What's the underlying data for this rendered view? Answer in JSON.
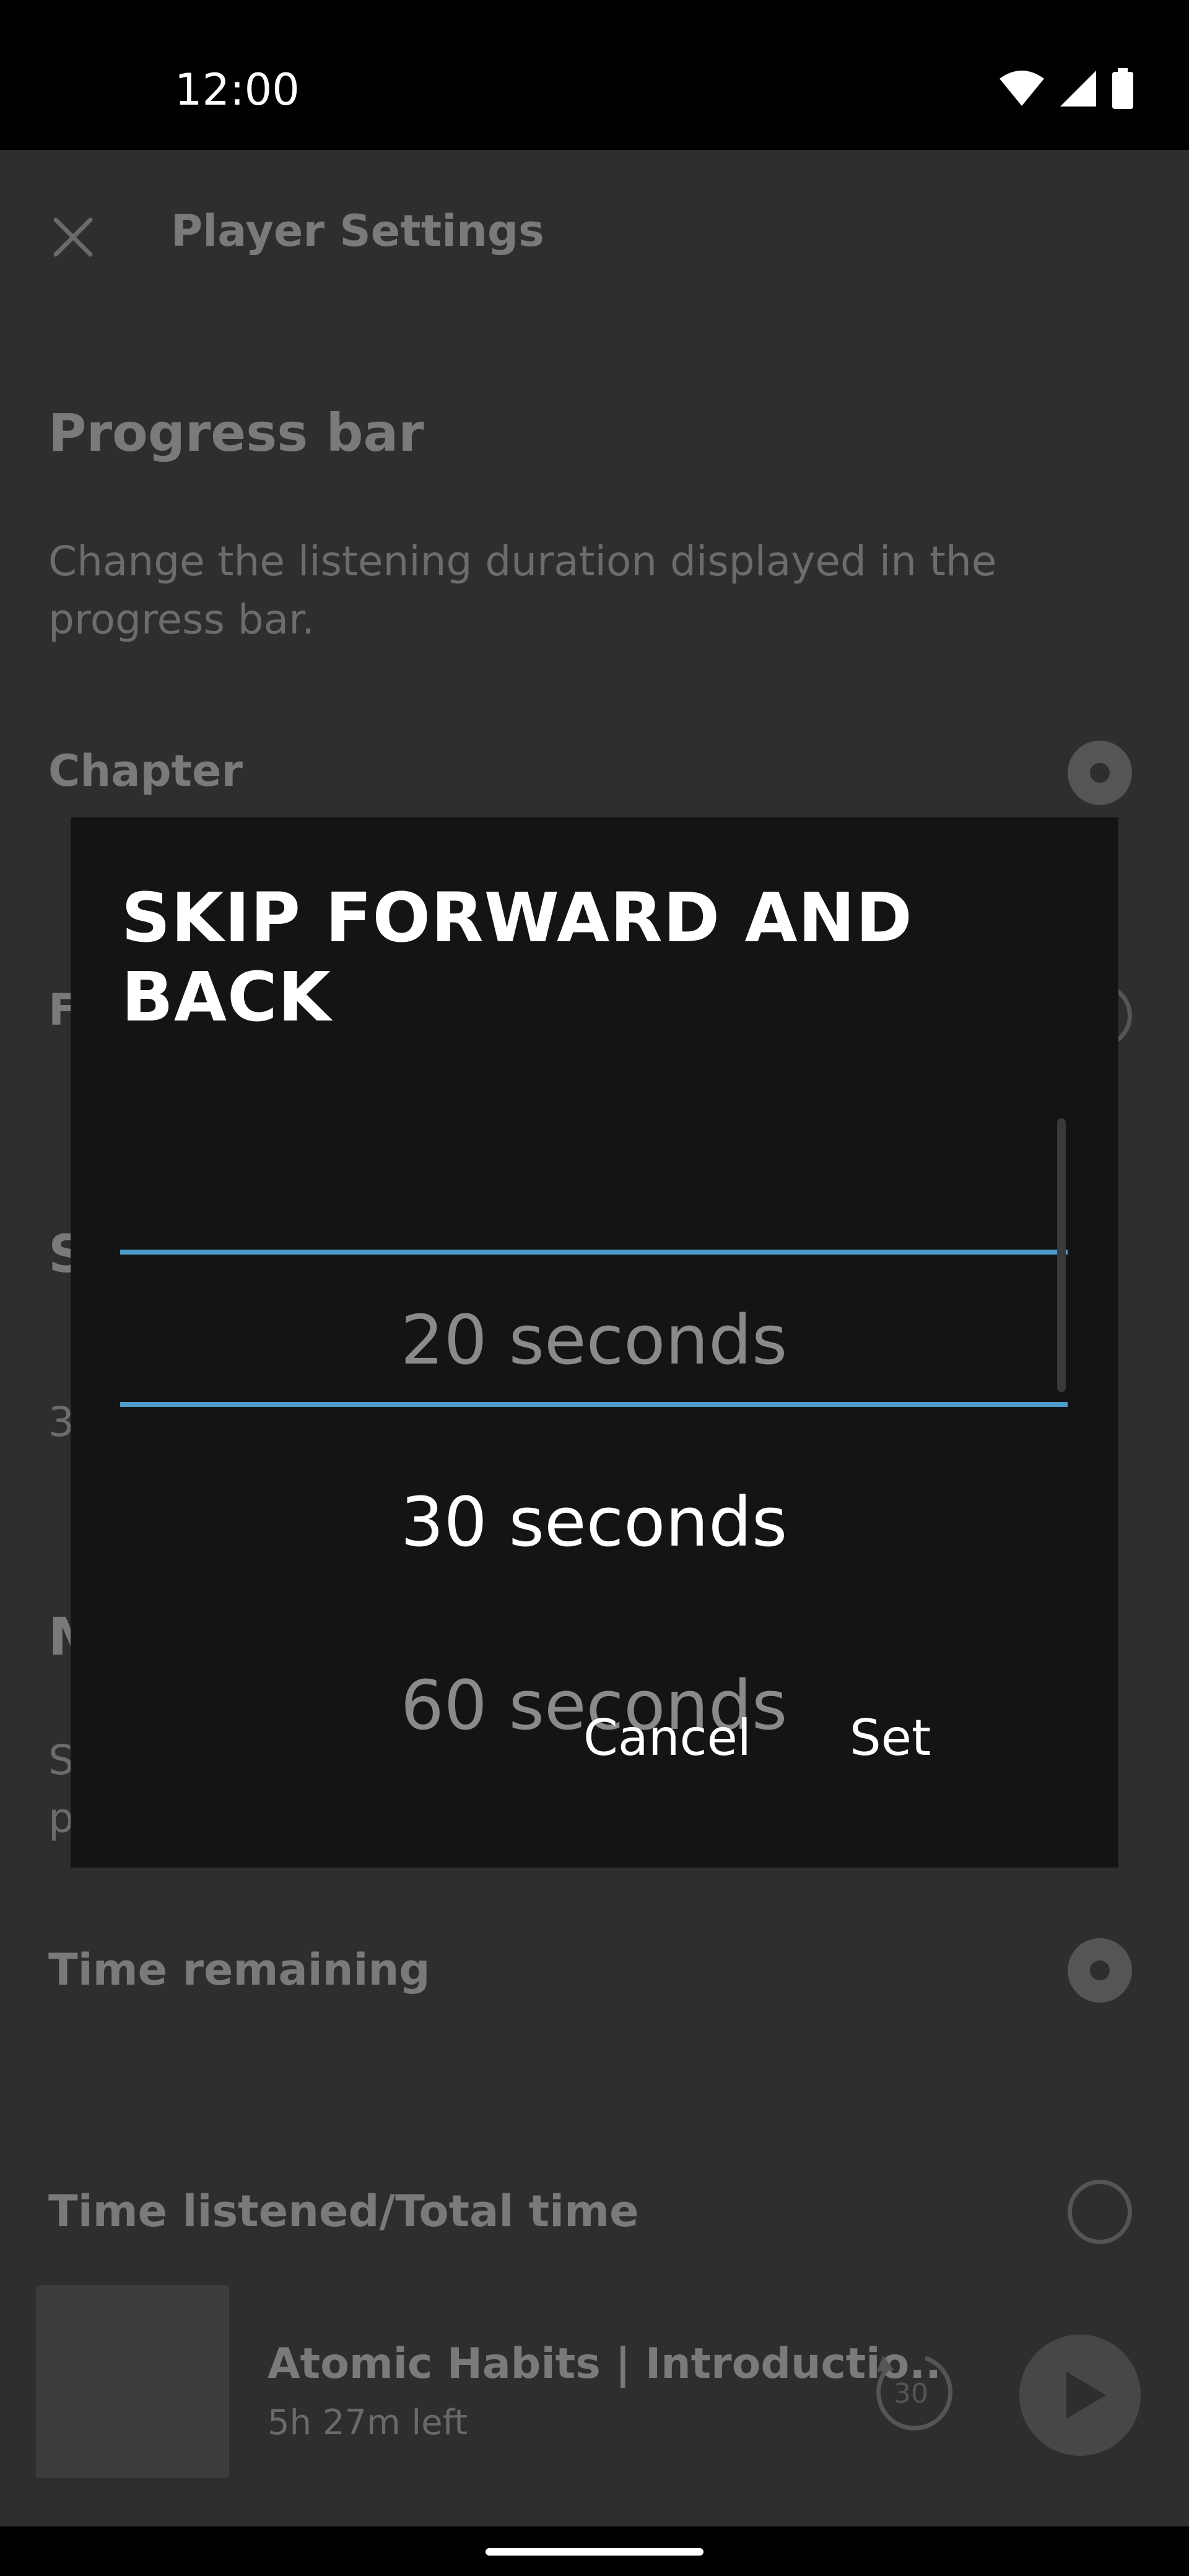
{
  "status_bar": {
    "time": "12:00"
  },
  "background": {
    "title": "Player Settings",
    "progress_heading": "Progress bar",
    "progress_desc": "Change the listening duration displayed in the progress bar.",
    "option_chapter": "Chapter",
    "partial_f": "F",
    "partial_s": "S",
    "partial_3": "3",
    "partial_m": "M",
    "partial_s2": "S",
    "partial_p": "p",
    "option_time_remaining": "Time remaining",
    "option_time_listened": "Time listened/Total time"
  },
  "mini_player": {
    "title": "Atomic Habits | Introductio..",
    "remaining": "5h 27m left",
    "skip_value": "30"
  },
  "dialog": {
    "title": "SKIP FORWARD AND BACK",
    "options_visible": [
      "20 seconds",
      "30 seconds",
      "60 seconds"
    ],
    "selected": "30 seconds",
    "cancel_label": "Cancel",
    "set_label": "Set",
    "accent_color": "#4d9ccc"
  }
}
